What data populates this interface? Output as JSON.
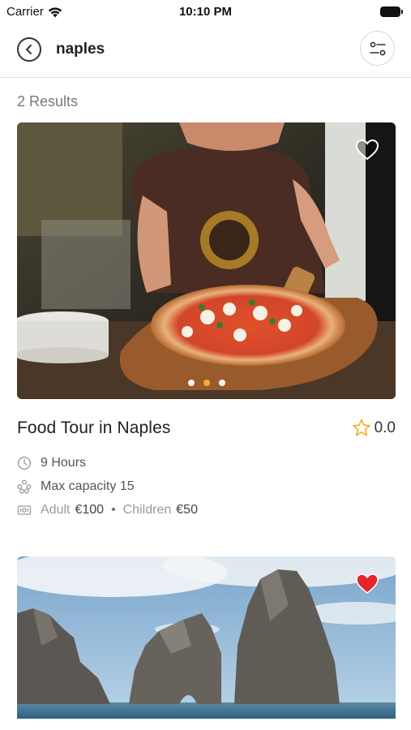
{
  "status_bar": {
    "carrier": "Carrier",
    "time": "10:10 PM"
  },
  "header": {
    "search_query": "naples",
    "back_icon": "back-chevron-circle-icon",
    "filter_icon": "filter-sliders-icon"
  },
  "results": {
    "count_label": "2 Results"
  },
  "cards": [
    {
      "title": "Food Tour in Naples",
      "rating": "0.0",
      "duration": "9 Hours",
      "capacity": "Max capacity 15",
      "adult_label": "Adult",
      "adult_price": "€100",
      "separator": "•",
      "children_label": "Children",
      "children_price": "€50",
      "favorite": false,
      "image": "pizza-chef-photo",
      "carousel_dots": 3,
      "carousel_active": 1
    },
    {
      "favorite": true,
      "image": "sea-stacks-photo"
    }
  ],
  "colors": {
    "accent": "#f2b533",
    "favorite_active": "#e4262c"
  }
}
